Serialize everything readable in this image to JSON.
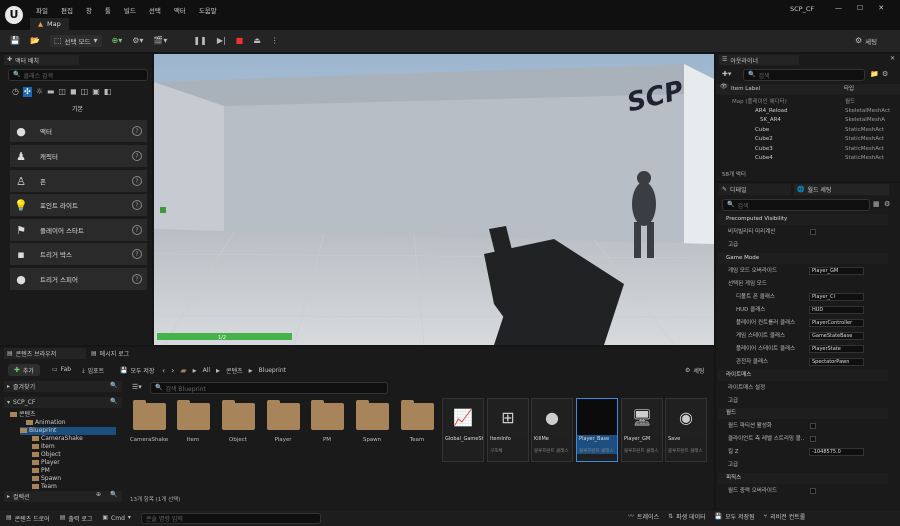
{
  "app": {
    "project": "SCP_CF",
    "tab": "Map"
  },
  "menu": [
    "파일",
    "편집",
    "창",
    "툴",
    "빌드",
    "선택",
    "액터",
    "도움말"
  ],
  "toolbar": {
    "mode": "선택 모드",
    "settings": "세팅"
  },
  "place_actors": {
    "title": "액터 배치",
    "search": "클래스 검색",
    "category": "기본",
    "items": [
      "액터",
      "캐릭터",
      "폰",
      "포인트 라이트",
      "플레이어 스타트",
      "트리거 박스",
      "트리거 스피어"
    ]
  },
  "viewport": {
    "wall_text": "SCP",
    "health": "1/2"
  },
  "outliner": {
    "title": "아웃라이너",
    "search": "검색",
    "col_label": "Item Label",
    "col_type": "타입",
    "rows": [
      {
        "label": "Map (플레이인 에디터)",
        "type": "월드"
      },
      {
        "label": "AR4_Reload",
        "type": "SkeletalMeshAct"
      },
      {
        "label": "SK_AR4",
        "type": "SkeletalMeshA"
      },
      {
        "label": "Cube",
        "type": "StaticMeshAct"
      },
      {
        "label": "Cube2",
        "type": "StaticMeshAct"
      },
      {
        "label": "Cube3",
        "type": "StaticMeshAct"
      },
      {
        "label": "Cube4",
        "type": "StaticMeshAct"
      }
    ],
    "count": "58개 액터"
  },
  "details": {
    "tab1": "디테일",
    "tab2": "월드 세팅",
    "search": "검색",
    "sections": {
      "precomputed": "Precomputed Visibility",
      "game_mode": "Game Mode",
      "lightmass": "라이트매스",
      "lightmass_settings": "라이트매스 설정",
      "world": "월드",
      "physics": "피직스"
    },
    "rows": {
      "visibility": "비저빌리티 미리계산",
      "advanced": "고급",
      "gm_override": "게임 모드 오버라이드",
      "gm_override_v": "Player_GM",
      "selected_gm": "선택된 게임 모드",
      "pawn": "디폴트 폰 클래스",
      "pawn_v": "Player_CI",
      "hud": "HUD 클래스",
      "hud_v": "HUD",
      "pc": "플레이어 컨트롤러 클래스",
      "pc_v": "PlayerController",
      "gs": "게임 스테이트 클래스",
      "gs_v": "GameStateBase",
      "ps": "플레이어 스테이트 클래스",
      "ps_v": "PlayerState",
      "spec": "관전자 클래스",
      "spec_v": "SpectatorPawn",
      "partition": "월드 파티션 활성화",
      "client_stream": "클라이언트 측 레벨 스트리밍 볼..",
      "killz": "킬 Z",
      "killz_v": "-1048575.0",
      "world_override": "월드 중력 오버라이드"
    }
  },
  "content": {
    "tab1": "콘텐츠 브라우저",
    "tab2": "메시지 로그",
    "add": "추가",
    "import_fab": "Fab",
    "import": "임포트",
    "save_all": "모두 저장",
    "breadcrumb": [
      "All",
      "콘텐츠",
      "Blueprint"
    ],
    "settings": "세팅",
    "search": "검색 Blueprint",
    "favorites": "즐겨찾기",
    "root": "SCP_CF",
    "tree": [
      "콘텐츠",
      "Animation",
      "Blueprint",
      "CameraShake",
      "Item",
      "Object",
      "Player",
      "PM",
      "Spawn",
      "Team"
    ],
    "collections": "컬렉션",
    "folders": [
      "CameraShake",
      "Item",
      "Object",
      "Player",
      "PM",
      "Spawn",
      "Team"
    ],
    "assets": [
      {
        "name": "Global_GameStyle_Base",
        "sub": ""
      },
      {
        "name": "ItemInfo",
        "sub": "구조체"
      },
      {
        "name": "KillMe",
        "sub": "블루프린트 클래스"
      },
      {
        "name": "Player_Base",
        "sub": "블루프린트 클래스"
      },
      {
        "name": "Player_GM",
        "sub": "블루프린트 클래스"
      },
      {
        "name": "Save",
        "sub": "블루프린트 클래스"
      }
    ],
    "status": "13개 항목 (1개 선택)"
  },
  "statusbar": {
    "drawer": "콘텐츠 드로어",
    "log": "출력 로그",
    "cmd": "Cmd",
    "console": "콘솔 명령 입력",
    "trace": "트레이스",
    "derived": "파생 데이터",
    "saved": "모두 저장됨",
    "source": "리비전 컨트롤"
  }
}
